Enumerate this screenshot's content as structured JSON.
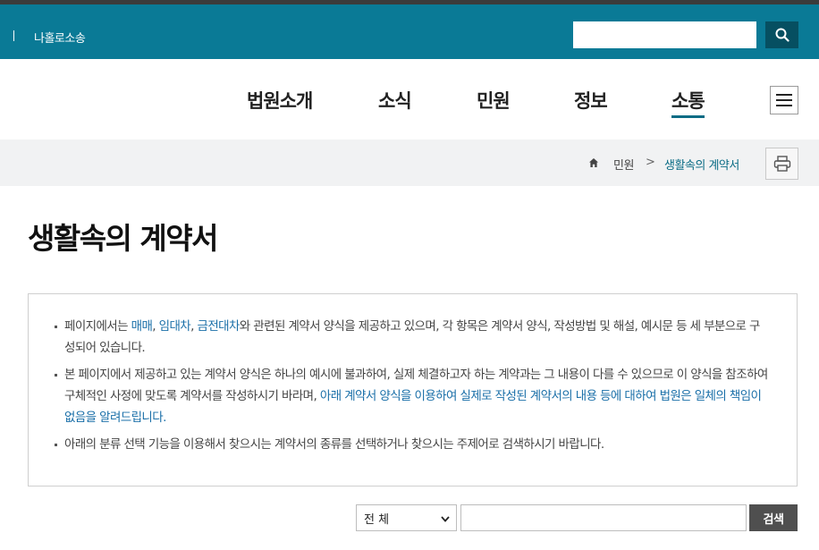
{
  "topbar": {
    "site_link": "나홀로소송",
    "search_placeholder": "",
    "search_icon": "search-icon"
  },
  "gnb": {
    "items": [
      {
        "label": "법원소개",
        "active": false
      },
      {
        "label": "소식",
        "active": false
      },
      {
        "label": "민원",
        "active": false
      },
      {
        "label": "정보",
        "active": false
      },
      {
        "label": "소통",
        "active": true
      }
    ],
    "menu_icon": "hamburger-menu-icon"
  },
  "breadcrumb": {
    "home_icon": "home-icon",
    "level1": "민원",
    "separator": ">",
    "current": "생활속의 계약서",
    "print_icon": "printer-icon"
  },
  "page": {
    "title": "생활속의 계약서"
  },
  "notice": {
    "item1": {
      "part1": "페이지에서는 ",
      "hl1": "매매",
      "sep1": ", ",
      "hl2": "임대차",
      "sep2": ", ",
      "hl3": "금전대차",
      "part2": "와 관련된 계약서 양식을 제공하고 있으며, 각 항목은 계약서 양식, 작성방법 및 해설, 예시문 등 세 부분으로 구성되어 있습니다."
    },
    "item2": {
      "part1": "본 페이지에서 제공하고 있는 계약서 양식은 하나의 예시에 불과하여, 실제 체결하고자 하는 계약과는 그 내용이 다를 수 있으므로 이 양식을 참조하여 구체적인 사정에 맞도록 계약서를 작성하시기 바라며, ",
      "hl": "아래 계약서 양식을 이용하여 실제로 작성된 계약서의 내용 등에 대하여 법원은 일체의 책임이 없음을 알려드립니다."
    },
    "item3": "아래의 분류 선택 기능을 이용해서 찾으시는 계약서의 종류를 선택하거나 찾으시는 주제어로 검색하시기 바랍니다."
  },
  "search": {
    "category_selected": "전 체",
    "keyword_value": "",
    "button_label": "검색"
  },
  "colors": {
    "topbar": "#0a7a96",
    "search_button": "#064f61",
    "accent": "#0a6c85",
    "link": "#1a6fa8",
    "search_go": "#4f4f4f"
  }
}
